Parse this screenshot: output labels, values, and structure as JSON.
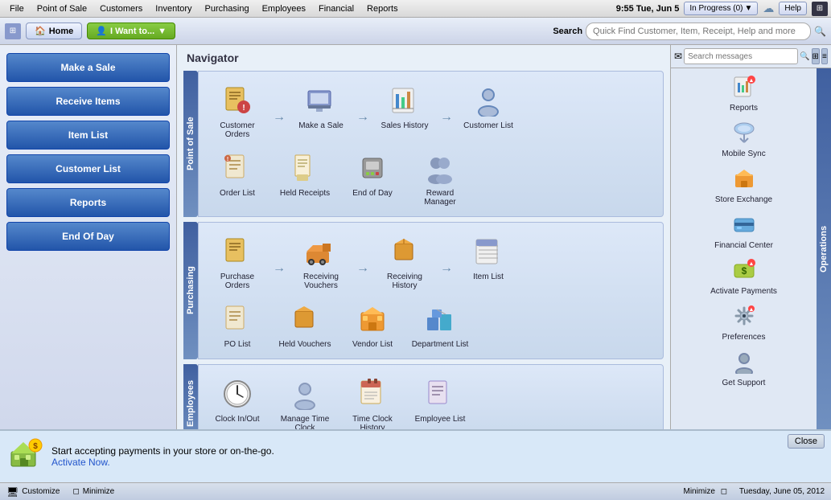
{
  "menuBar": {
    "items": [
      "File",
      "Point of Sale",
      "Customers",
      "Inventory",
      "Purchasing",
      "Employees",
      "Financial",
      "Reports"
    ],
    "clock": "9:55 Tue, Jun 5",
    "inProgress": "In Progress (0)",
    "help": "Help"
  },
  "toolbar": {
    "homeLabel": "Home",
    "iwantLabel": "I Want to...",
    "searchLabel": "Search",
    "searchPlaceholder": "Quick Find Customer, Item, Receipt, Help and more"
  },
  "sidebar": {
    "buttons": [
      "Make a Sale",
      "Receive Items",
      "Item List",
      "Customer List",
      "Reports",
      "End Of Day"
    ]
  },
  "navigator": {
    "title": "Navigator",
    "sections": {
      "pointOfSale": {
        "label": "Point of Sale",
        "items": [
          {
            "label": "Customer Orders",
            "icon": "📋"
          },
          {
            "label": "Make a Sale",
            "icon": "🖥️"
          },
          {
            "label": "Sales History",
            "icon": "📊"
          },
          {
            "label": "Customer List",
            "icon": "👤"
          },
          {
            "label": "Order List",
            "icon": "📄"
          },
          {
            "label": "Held Receipts",
            "icon": "🧾"
          },
          {
            "label": "End of Day",
            "icon": "🏧"
          },
          {
            "label": "Reward Manager",
            "icon": "👥"
          }
        ]
      },
      "purchasing": {
        "label": "Purchasing",
        "items": [
          {
            "label": "Purchase Orders",
            "icon": "📋"
          },
          {
            "label": "Receiving Vouchers",
            "icon": "🚛"
          },
          {
            "label": "Receiving History",
            "icon": "📦"
          },
          {
            "label": "Item List",
            "icon": "📊"
          },
          {
            "label": "PO List",
            "icon": "📄"
          },
          {
            "label": "Held Vouchers",
            "icon": "📦"
          },
          {
            "label": "Vendor List",
            "icon": "🏪"
          },
          {
            "label": "Department List",
            "icon": "📁"
          }
        ]
      },
      "employees": {
        "label": "Employees",
        "items": [
          {
            "label": "Clock In/Out",
            "icon": "🕐"
          },
          {
            "label": "Manage Time Clock",
            "icon": "👤"
          },
          {
            "label": "Time Clock History",
            "icon": "📅"
          },
          {
            "label": "Employee List",
            "icon": "📋"
          }
        ]
      }
    }
  },
  "operations": {
    "items": [
      {
        "label": "Reports",
        "icon": "📊"
      },
      {
        "label": "Mobile Sync",
        "icon": "☁️"
      },
      {
        "label": "Store Exchange",
        "icon": "🏪"
      },
      {
        "label": "Financial Center",
        "icon": "💳"
      },
      {
        "label": "Activate Payments",
        "icon": "💰"
      },
      {
        "label": "Preferences",
        "icon": "🔧"
      },
      {
        "label": "Get Support",
        "icon": "👤"
      }
    ]
  },
  "promo": {
    "text": "Start accepting payments in your store or on-the-go.",
    "linkText": "Activate Now.",
    "closeLabel": "Close"
  },
  "statusBar": {
    "customizeLabel": "Customize",
    "minimizeLabel": "Minimize",
    "rightText": "Minimize",
    "dateText": "Tuesday, June 05, 2012"
  },
  "msgSearch": {
    "placeholder": "Search messages"
  }
}
